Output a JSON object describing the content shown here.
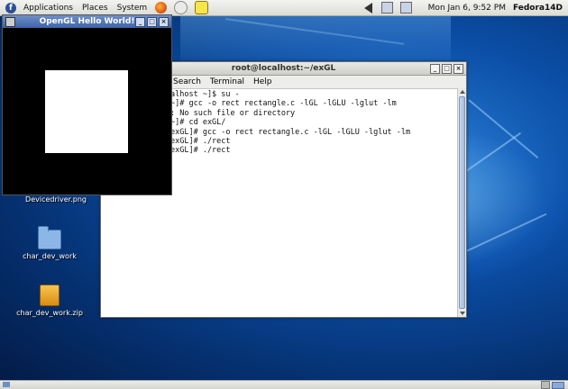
{
  "top_panel": {
    "menus": [
      "Applications",
      "Places",
      "System"
    ],
    "clock": "Mon Jan  6,  9:52 PM",
    "hostname": "Fedora14D",
    "logo": "f"
  },
  "desktop_icons": [
    {
      "label": "Devicedriver.png",
      "icon": "image-file-icon"
    },
    {
      "label": "char_dev_work",
      "icon": "folder-icon"
    },
    {
      "label": "char_dev_work.zip",
      "icon": "zip-archive-icon"
    }
  ],
  "terminal": {
    "title": "root@localhost:~/exGL",
    "menu": [
      "Search",
      "Terminal",
      "Help"
    ],
    "lines": [
      "alhost ~]$ su -",
      "",
      "~]# gcc -o rect rectangle.c -lGL -lGLU -lglut -lm",
      ": No such file or directory",
      "~]# cd exGL/",
      "exGL]# gcc -o rect rectangle.c -lGL -lGLU -lglut -lm",
      "exGL]# ./rect",
      "exGL]# ./rect"
    ]
  },
  "gl_window": {
    "title": "OpenGL Hello World!"
  },
  "window_buttons": {
    "minimize": "_",
    "maximize": "□",
    "close": "×"
  }
}
